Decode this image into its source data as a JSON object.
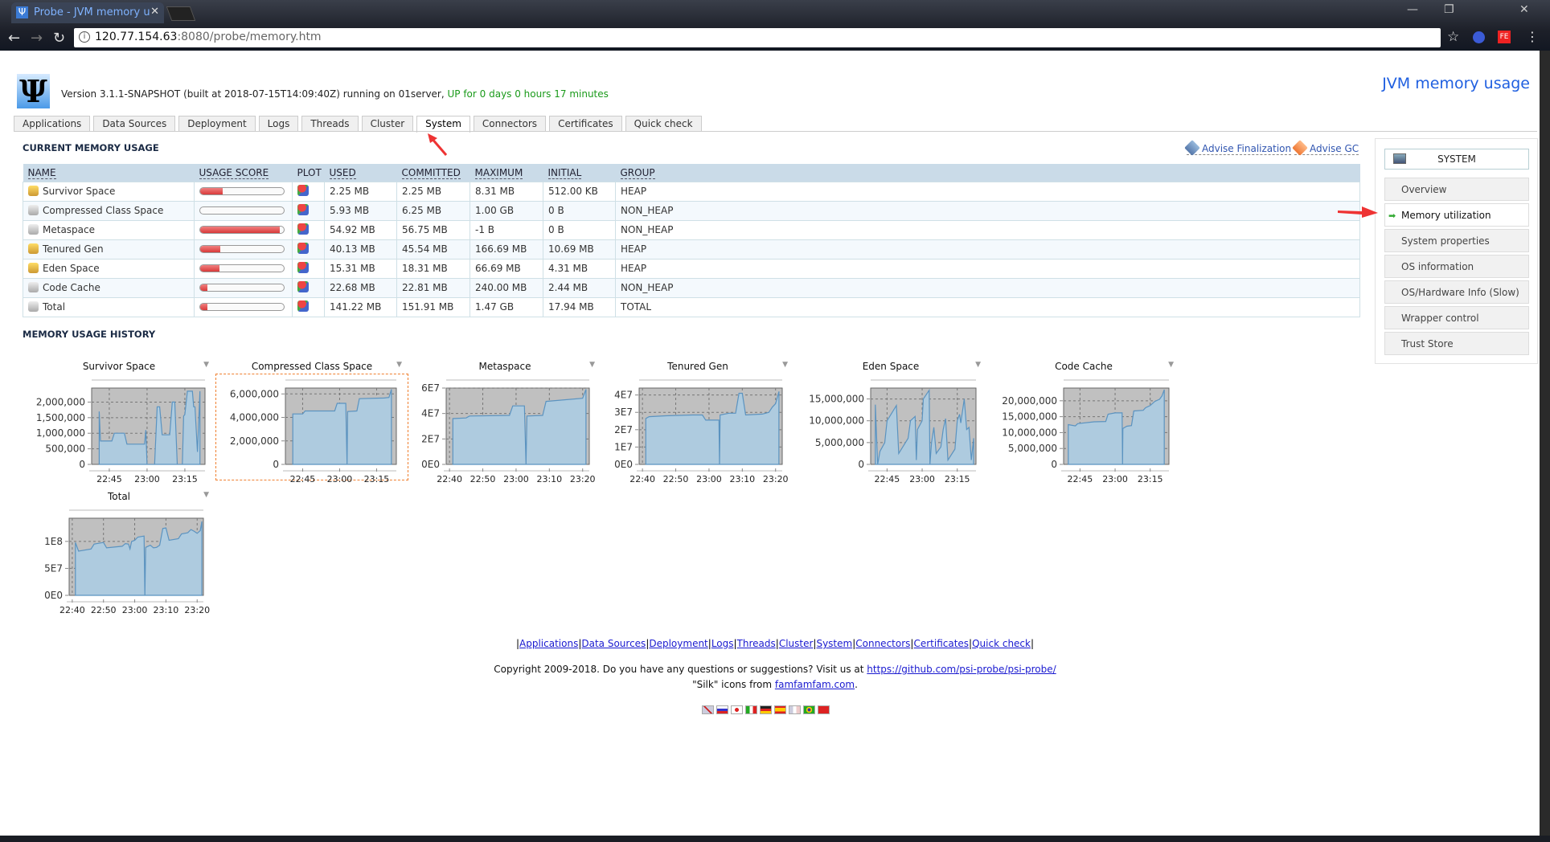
{
  "browser": {
    "tab_title": "Probe - JVM memory u",
    "url_host": "120.77.154.63",
    "url_rest": ":8080/probe/memory.htm"
  },
  "header": {
    "version_text": "Version 3.1.1-SNAPSHOT (built at 2018-07-15T14:09:40Z) running on 01server,",
    "uptime_text": "UP for 0 days 0 hours 17 minutes",
    "page_title": "JVM memory usage"
  },
  "tabs": [
    "Applications",
    "Data Sources",
    "Deployment",
    "Logs",
    "Threads",
    "Cluster",
    "System",
    "Connectors",
    "Certificates",
    "Quick check"
  ],
  "active_tab": "System",
  "current": {
    "title": "CURRENT MEMORY USAGE",
    "advise_finalization": "Advise Finalization",
    "advise_gc": "Advise GC",
    "columns": [
      "NAME",
      "USAGE SCORE",
      "PLOT",
      "USED",
      "COMMITTED",
      "MAXIMUM",
      "INITIAL",
      "GROUP"
    ],
    "rows": [
      {
        "name": "Survivor Space",
        "score": 0.27,
        "used": "2.25 MB",
        "committed": "2.25 MB",
        "maximum": "8.31 MB",
        "initial": "512.00 KB",
        "group": "HEAP"
      },
      {
        "name": "Compressed Class Space",
        "score": 0.0,
        "used": "5.93 MB",
        "committed": "6.25 MB",
        "maximum": "1.00 GB",
        "initial": "0 B",
        "group": "NON_HEAP"
      },
      {
        "name": "Metaspace",
        "score": 0.95,
        "used": "54.92 MB",
        "committed": "56.75 MB",
        "maximum": "-1 B",
        "initial": "0 B",
        "group": "NON_HEAP"
      },
      {
        "name": "Tenured Gen",
        "score": 0.24,
        "used": "40.13 MB",
        "committed": "45.54 MB",
        "maximum": "166.69 MB",
        "initial": "10.69 MB",
        "group": "HEAP"
      },
      {
        "name": "Eden Space",
        "score": 0.23,
        "used": "15.31 MB",
        "committed": "18.31 MB",
        "maximum": "66.69 MB",
        "initial": "4.31 MB",
        "group": "HEAP"
      },
      {
        "name": "Code Cache",
        "score": 0.09,
        "used": "22.68 MB",
        "committed": "22.81 MB",
        "maximum": "240.00 MB",
        "initial": "2.44 MB",
        "group": "NON_HEAP"
      },
      {
        "name": "Total",
        "score": 0.09,
        "used": "141.22 MB",
        "committed": "151.91 MB",
        "maximum": "1.47 GB",
        "initial": "17.94 MB",
        "group": "TOTAL"
      }
    ]
  },
  "sidebar": {
    "title": "SYSTEM",
    "items": [
      "Overview",
      "Memory utilization",
      "System properties",
      "OS information",
      "OS/Hardware Info (Slow)",
      "Wrapper control",
      "Trust Store"
    ],
    "current": "Memory utilization"
  },
  "history": {
    "title": "MEMORY USAGE HISTORY"
  },
  "colors": {
    "area_fill": "#aecbdf",
    "area_line": "#5b93c0",
    "plot_bg": "#c0c0c0",
    "link": "#1a1ad0",
    "uptime": "#1a9a1a",
    "title": "#1f5fe0"
  },
  "chart_data": [
    {
      "type": "area",
      "title": "Survivor Space",
      "xlim": [
        "22:38",
        "23:23"
      ],
      "ylim": [
        0,
        2450000
      ],
      "xticks": [
        "22:45",
        "23:00",
        "23:15"
      ],
      "yticks": [
        {
          "v": 0,
          "l": "0"
        },
        {
          "v": 500000,
          "l": "500,000"
        },
        {
          "v": 1000000,
          "l": "1,000,000"
        },
        {
          "v": 1500000,
          "l": "1,500,000"
        },
        {
          "v": 2000000,
          "l": "2,000,000"
        }
      ],
      "points": [
        [
          "22:41",
          1700000
        ],
        [
          "22:41:30",
          750000
        ],
        [
          "22:46",
          750000
        ],
        [
          "22:47",
          1000000
        ],
        [
          "22:51",
          1000000
        ],
        [
          "22:52",
          650000
        ],
        [
          "22:59",
          650000
        ],
        [
          "22:59:30",
          1100000
        ],
        [
          "23:00",
          0
        ],
        [
          "23:03",
          0
        ],
        [
          "23:04",
          1850000
        ],
        [
          "23:05",
          1850000
        ],
        [
          "23:06",
          950000
        ],
        [
          "23:09",
          950000
        ],
        [
          "23:10",
          2000000
        ],
        [
          "23:11",
          2000000
        ],
        [
          "23:12",
          0
        ],
        [
          "23:14",
          0
        ],
        [
          "23:14:30",
          1550000
        ],
        [
          "23:15",
          1600000
        ],
        [
          "23:16",
          2350000
        ],
        [
          "23:18",
          2350000
        ],
        [
          "23:18:30",
          1850000
        ],
        [
          "23:19",
          1850000
        ],
        [
          "23:20",
          400000
        ],
        [
          "23:21",
          2350000
        ]
      ]
    },
    {
      "type": "area",
      "title": "Compressed Class Space",
      "xlim": [
        "22:38",
        "23:23"
      ],
      "ylim": [
        0,
        6500000
      ],
      "xticks": [
        "22:45",
        "23:00",
        "23:15"
      ],
      "yticks": [
        {
          "v": 0,
          "l": "0"
        },
        {
          "v": 2000000,
          "l": "2,000,000"
        },
        {
          "v": 4000000,
          "l": "4,000,000"
        },
        {
          "v": 6000000,
          "l": "6,000,000"
        }
      ],
      "points": [
        [
          "22:41",
          4300000
        ],
        [
          "22:45",
          4300000
        ],
        [
          "22:46",
          4550000
        ],
        [
          "22:58",
          4550000
        ],
        [
          "22:59",
          5200000
        ],
        [
          "23:02:30",
          5200000
        ],
        [
          "23:03",
          0
        ],
        [
          "23:03:15",
          4500000
        ],
        [
          "23:07",
          4550000
        ],
        [
          "23:08",
          5600000
        ],
        [
          "23:18",
          5650000
        ],
        [
          "23:20",
          5700000
        ],
        [
          "23:21",
          6400000
        ]
      ]
    },
    {
      "type": "area",
      "title": "Metaspace",
      "xlim": [
        "22:39",
        "23:22"
      ],
      "ylim": [
        0,
        60000000
      ],
      "xticks": [
        "22:40",
        "22:50",
        "23:00",
        "23:10",
        "23:20"
      ],
      "yticks": [
        {
          "v": 0,
          "l": "0E0"
        },
        {
          "v": 20000000,
          "l": "2E7"
        },
        {
          "v": 40000000,
          "l": "4E7"
        },
        {
          "v": 60000000,
          "l": "6E7"
        }
      ],
      "points": [
        [
          "22:41",
          36000000
        ],
        [
          "22:45",
          36500000
        ],
        [
          "22:46",
          38000000
        ],
        [
          "22:58",
          38500000
        ],
        [
          "22:59",
          46000000
        ],
        [
          "23:02:30",
          46000000
        ],
        [
          "23:03",
          0
        ],
        [
          "23:03:15",
          38000000
        ],
        [
          "23:08",
          38500000
        ],
        [
          "23:09",
          49500000
        ],
        [
          "23:20",
          52000000
        ],
        [
          "23:21",
          59000000
        ]
      ]
    },
    {
      "type": "area",
      "title": "Tenured Gen",
      "xlim": [
        "22:39",
        "23:22"
      ],
      "ylim": [
        0,
        44000000
      ],
      "xticks": [
        "22:40",
        "22:50",
        "23:00",
        "23:10",
        "23:20"
      ],
      "yticks": [
        {
          "v": 0,
          "l": "0E0"
        },
        {
          "v": 10000000,
          "l": "1E7"
        },
        {
          "v": 20000000,
          "l": "2E7"
        },
        {
          "v": 30000000,
          "l": "3E7"
        },
        {
          "v": 40000000,
          "l": "4E7"
        }
      ],
      "points": [
        [
          "22:41",
          26500000
        ],
        [
          "22:42",
          27500000
        ],
        [
          "22:47",
          28000000
        ],
        [
          "22:55",
          28500000
        ],
        [
          "22:58",
          28500000
        ],
        [
          "22:59",
          25500000
        ],
        [
          "23:03",
          25500000
        ],
        [
          "23:03:10",
          0
        ],
        [
          "23:03:20",
          28500000
        ],
        [
          "23:06",
          29500000
        ],
        [
          "23:08",
          29500000
        ],
        [
          "23:09",
          41000000
        ],
        [
          "23:10",
          41000000
        ],
        [
          "23:11",
          28500000
        ],
        [
          "23:16",
          29000000
        ],
        [
          "23:18",
          30000000
        ],
        [
          "23:19",
          33000000
        ],
        [
          "23:20",
          35000000
        ],
        [
          "23:21",
          42000000
        ]
      ]
    },
    {
      "type": "area",
      "title": "Eden Space",
      "xlim": [
        "22:38",
        "23:23"
      ],
      "ylim": [
        0,
        17500000
      ],
      "xticks": [
        "22:45",
        "23:00",
        "23:15"
      ],
      "yticks": [
        {
          "v": 0,
          "l": "0"
        },
        {
          "v": 5000000,
          "l": "5,000,000"
        },
        {
          "v": 10000000,
          "l": "10,000,000"
        },
        {
          "v": 15000000,
          "l": "15,000,000"
        }
      ],
      "points": [
        [
          "22:40",
          13700000
        ],
        [
          "22:41",
          0
        ],
        [
          "22:42",
          3000000
        ],
        [
          "22:44",
          5000000
        ],
        [
          "22:45",
          10000000
        ],
        [
          "22:49",
          13500000
        ],
        [
          "22:50",
          2500000
        ],
        [
          "22:54",
          6000000
        ],
        [
          "22:55",
          10000000
        ],
        [
          "22:57",
          11000000
        ],
        [
          "22:57:30",
          1000000
        ],
        [
          "22:58",
          8000000
        ],
        [
          "23:00",
          10000000
        ],
        [
          "23:00:30",
          15000000
        ],
        [
          "23:03",
          17000000
        ],
        [
          "23:03:20",
          0
        ],
        [
          "23:04",
          5000000
        ],
        [
          "23:05",
          8500000
        ],
        [
          "23:06",
          2500000
        ],
        [
          "23:08",
          4000000
        ],
        [
          "23:09",
          8000000
        ],
        [
          "23:10",
          10500000
        ],
        [
          "23:11",
          1000000
        ],
        [
          "23:14",
          3500000
        ],
        [
          "23:15",
          10000000
        ],
        [
          "23:16",
          11500000
        ],
        [
          "23:16:30",
          9500000
        ],
        [
          "23:18",
          15000000
        ],
        [
          "23:19",
          8000000
        ],
        [
          "23:20",
          8500000
        ],
        [
          "23:21",
          1000000
        ],
        [
          "23:22",
          6000000
        ]
      ]
    },
    {
      "type": "area",
      "title": "Code Cache",
      "xlim": [
        "22:38",
        "23:23"
      ],
      "ylim": [
        0,
        24000000
      ],
      "xticks": [
        "22:45",
        "23:00",
        "23:15"
      ],
      "yticks": [
        {
          "v": 0,
          "l": "0"
        },
        {
          "v": 5000000,
          "l": "5,000,000"
        },
        {
          "v": 10000000,
          "l": "10,000,000"
        },
        {
          "v": 15000000,
          "l": "15,000,000"
        },
        {
          "v": 20000000,
          "l": "20,000,000"
        }
      ],
      "points": [
        [
          "22:40",
          12500000
        ],
        [
          "22:43",
          12100000
        ],
        [
          "22:44",
          12800000
        ],
        [
          "22:51",
          13400000
        ],
        [
          "22:56",
          13500000
        ],
        [
          "22:57",
          15800000
        ],
        [
          "23:00",
          16200000
        ],
        [
          "23:03",
          16200000
        ],
        [
          "23:03:10",
          0
        ],
        [
          "23:03:20",
          11300000
        ],
        [
          "23:05",
          12000000
        ],
        [
          "23:07",
          12200000
        ],
        [
          "23:08",
          16800000
        ],
        [
          "23:12",
          17000000
        ],
        [
          "23:13",
          17800000
        ],
        [
          "23:15",
          18500000
        ],
        [
          "23:17",
          19800000
        ],
        [
          "23:19",
          20500000
        ],
        [
          "23:20",
          21500000
        ],
        [
          "23:21",
          23500000
        ]
      ]
    },
    {
      "type": "area",
      "title": "Total",
      "xlim": [
        "22:39",
        "23:22"
      ],
      "ylim": [
        0,
        143000000
      ],
      "xticks": [
        "22:40",
        "22:50",
        "23:00",
        "23:10",
        "23:20"
      ],
      "yticks": [
        {
          "v": 0,
          "l": "0E0"
        },
        {
          "v": 50000000,
          "l": "5E7"
        },
        {
          "v": 100000000,
          "l": "1E8"
        }
      ],
      "points": [
        [
          "22:41",
          98000000
        ],
        [
          "22:42",
          82000000
        ],
        [
          "22:46",
          86000000
        ],
        [
          "22:47",
          95000000
        ],
        [
          "22:50",
          98000000
        ],
        [
          "22:51",
          88000000
        ],
        [
          "22:56",
          91000000
        ],
        [
          "22:57",
          96000000
        ],
        [
          "22:58",
          95000000
        ],
        [
          "22:58:30",
          86000000
        ],
        [
          "22:59",
          100000000
        ],
        [
          "23:00",
          102000000
        ],
        [
          "23:01",
          108000000
        ],
        [
          "23:03",
          110000000
        ],
        [
          "23:03:15",
          0
        ],
        [
          "23:03:30",
          89000000
        ],
        [
          "23:05",
          93000000
        ],
        [
          "23:06",
          88000000
        ],
        [
          "23:07",
          89000000
        ],
        [
          "23:08",
          93000000
        ],
        [
          "23:09",
          124000000
        ],
        [
          "23:10",
          125000000
        ],
        [
          "23:11",
          102000000
        ],
        [
          "23:14",
          105000000
        ],
        [
          "23:15",
          114000000
        ],
        [
          "23:17",
          116000000
        ],
        [
          "23:18",
          122000000
        ],
        [
          "23:19",
          119000000
        ],
        [
          "23:20",
          115000000
        ],
        [
          "23:21",
          120000000
        ],
        [
          "23:21:30",
          137000000
        ]
      ]
    }
  ],
  "footer": {
    "links": [
      "Applications",
      "Data Sources",
      "Deployment",
      "Logs",
      "Threads",
      "Cluster",
      "System",
      "Connectors",
      "Certificates",
      "Quick check"
    ],
    "copyright": "Copyright 2009-2018. Do you have any questions or suggestions? Visit us at",
    "github": "https://github.com/psi-probe/psi-probe/",
    "silk_prefix": "\"Silk\" icons from",
    "silk_link": "famfamfam.com",
    "flags": [
      "en",
      "ru",
      "ja",
      "it",
      "de",
      "es",
      "fr",
      "pt-br",
      "zh-cn"
    ]
  }
}
